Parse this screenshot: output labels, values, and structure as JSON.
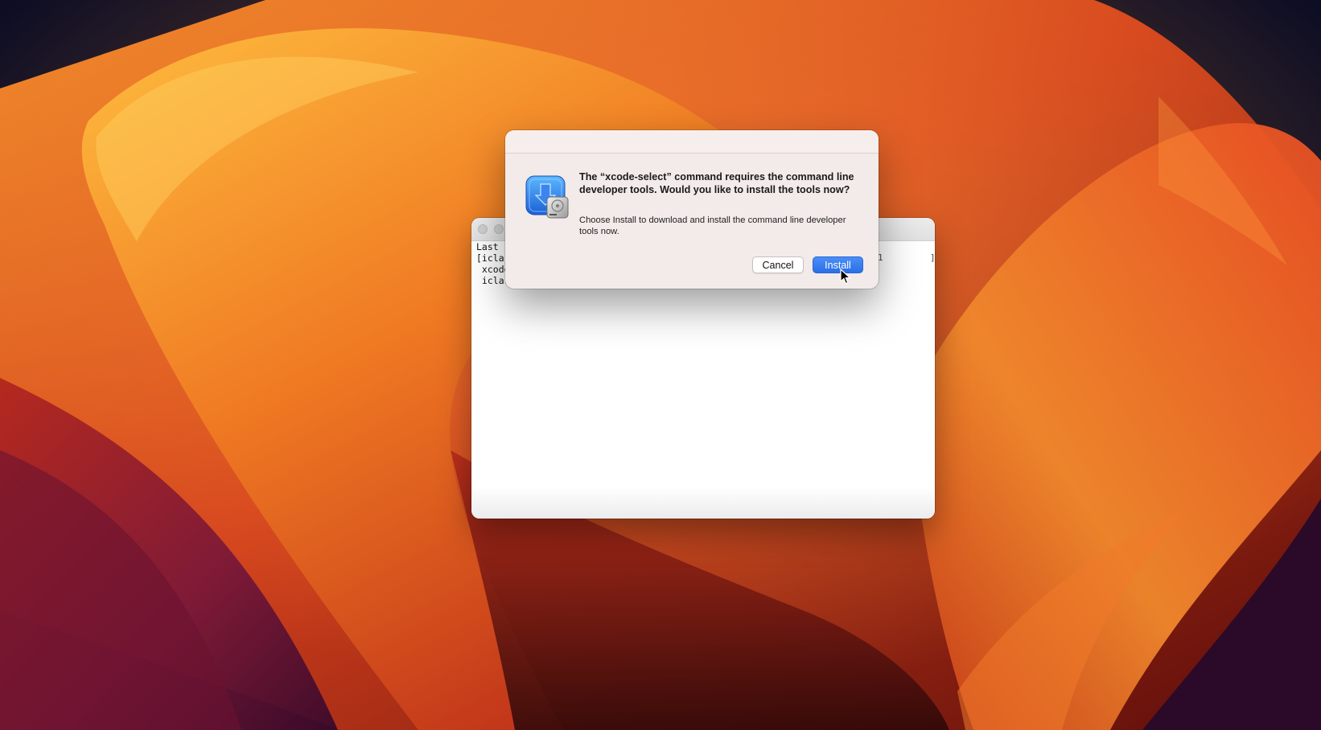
{
  "terminal": {
    "lines": [
      "Last",
      "[iclar",
      " xcode",
      " iclar"
    ],
    "right_fragments": [
      "1",
      "]"
    ]
  },
  "dialog": {
    "title": "The “xcode-select” command requires the command line developer tools. Would you like to install the tools now?",
    "message": "Choose Install to download and install the command line developer tools now.",
    "icon": "developer-tools-installer-icon",
    "buttons": {
      "cancel_label": "Cancel",
      "install_label": "Install"
    }
  },
  "colors": {
    "install_button": "#2f76ea",
    "dialog_background": "#f3ebe9",
    "wallpaper_primary": "#e8572a"
  }
}
